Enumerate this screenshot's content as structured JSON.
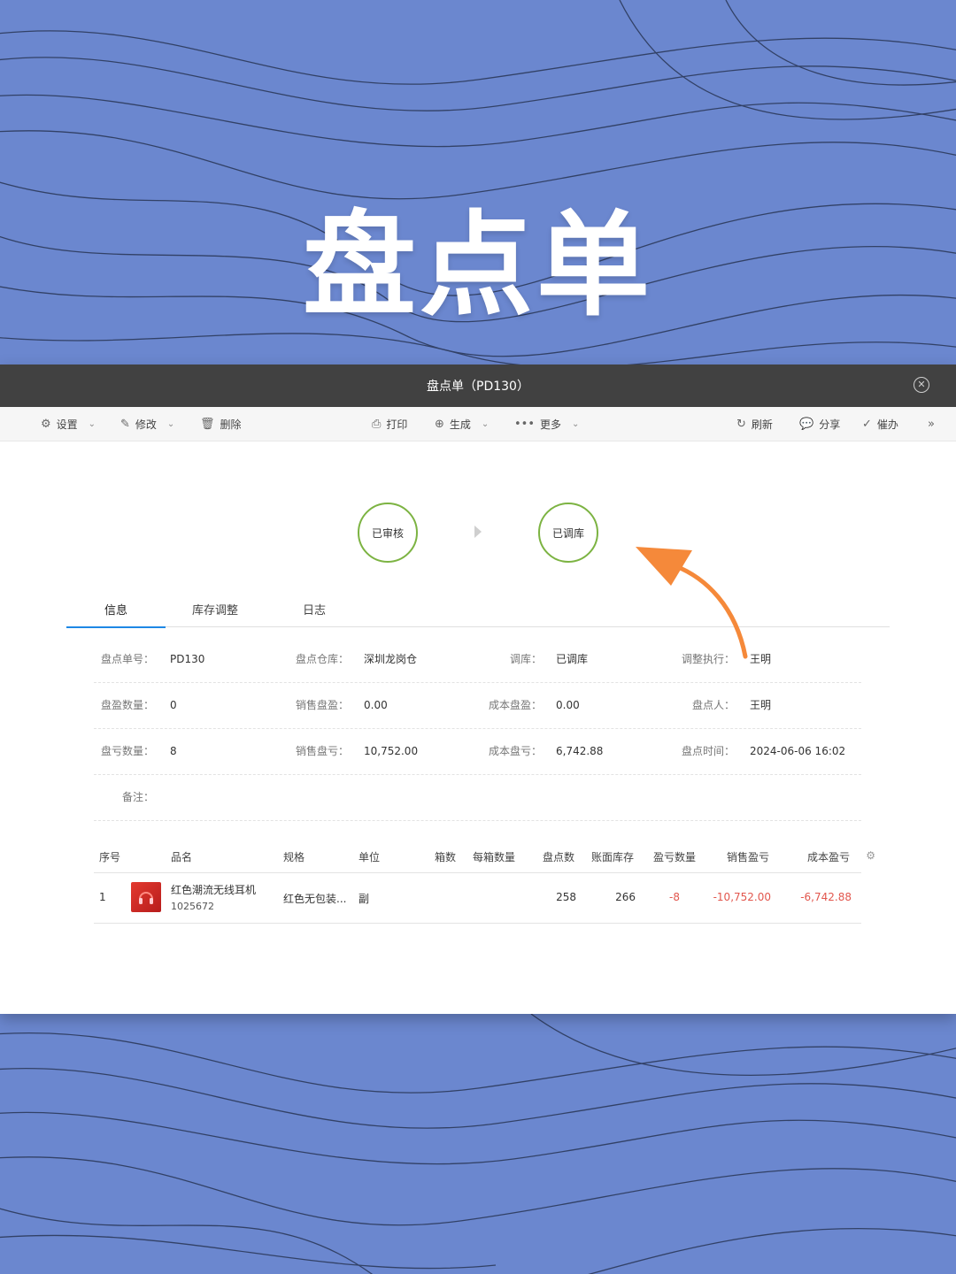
{
  "hero": {
    "title": "盘点单"
  },
  "window": {
    "title": "盘点单（PD130）",
    "close_symbol": "✕"
  },
  "toolbar": {
    "left": [
      {
        "label": "设置",
        "icon": "gear-icon",
        "has_caret": true
      },
      {
        "label": "修改",
        "icon": "edit-icon",
        "has_caret": true
      },
      {
        "label": "删除",
        "icon": "trash-icon",
        "has_caret": false
      }
    ],
    "center": [
      {
        "label": "打印",
        "icon": "printer-icon",
        "has_caret": false
      },
      {
        "label": "生成",
        "icon": "plus-circle-icon",
        "has_caret": true
      },
      {
        "label": "更多",
        "icon": "more-icon",
        "has_caret": true
      }
    ],
    "right": [
      {
        "label": "刷新",
        "icon": "refresh-icon"
      },
      {
        "label": "分享",
        "icon": "share-icon"
      },
      {
        "label": "催办",
        "icon": "check-circle-icon"
      }
    ],
    "expand_symbol": "»"
  },
  "steps": [
    {
      "label": "已审核"
    },
    {
      "label": "已调库"
    }
  ],
  "tabs": [
    {
      "label": "信息",
      "active": true
    },
    {
      "label": "库存调整",
      "active": false
    },
    {
      "label": "日志",
      "active": false
    }
  ],
  "info": {
    "order_no": {
      "label": "盘点单号：",
      "value": "PD130"
    },
    "warehouse": {
      "label": "盘点仓库：",
      "value": "深圳龙岗仓"
    },
    "adjusted": {
      "label": "调库：",
      "value": "已调库"
    },
    "executor": {
      "label": "调整执行：",
      "value": "王明"
    },
    "surplus_qty": {
      "label": "盘盈数量：",
      "value": "0"
    },
    "sales_surplus": {
      "label": "销售盘盈：",
      "value": "0.00"
    },
    "cost_surplus": {
      "label": "成本盘盈：",
      "value": "0.00"
    },
    "counter": {
      "label": "盘点人：",
      "value": "王明"
    },
    "loss_qty": {
      "label": "盘亏数量：",
      "value": "8"
    },
    "sales_loss": {
      "label": "销售盘亏：",
      "value": "10,752.00"
    },
    "cost_loss": {
      "label": "成本盘亏：",
      "value": "6,742.88"
    },
    "count_time": {
      "label": "盘点时间：",
      "value": "2024-06-06 16:02"
    },
    "remark": {
      "label": "备注：",
      "value": ""
    }
  },
  "table": {
    "headers": {
      "index": "序号",
      "name": "品名",
      "spec": "规格",
      "unit": "单位",
      "boxes": "箱数",
      "per_box": "每箱数量",
      "counted": "盘点数",
      "book_stock": "账面库存",
      "diff_qty": "盈亏数量",
      "sales_diff": "销售盈亏",
      "cost_diff": "成本盈亏"
    },
    "rows": [
      {
        "index": "1",
        "name": "红色潮流无线耳机",
        "code": "1025672",
        "spec": "红色无包装...",
        "unit": "副",
        "boxes": "",
        "per_box": "",
        "counted": "258",
        "book_stock": "266",
        "diff_qty": "-8",
        "sales_diff": "-10,752.00",
        "cost_diff": "-6,742.88"
      }
    ]
  },
  "colors": {
    "background": "#6b87cf",
    "titlebar": "#414141",
    "step_ring": "#7cb342",
    "tab_active": "#1e88e5",
    "negative": "#e2564d",
    "annotation_arrow": "#f5893a"
  }
}
